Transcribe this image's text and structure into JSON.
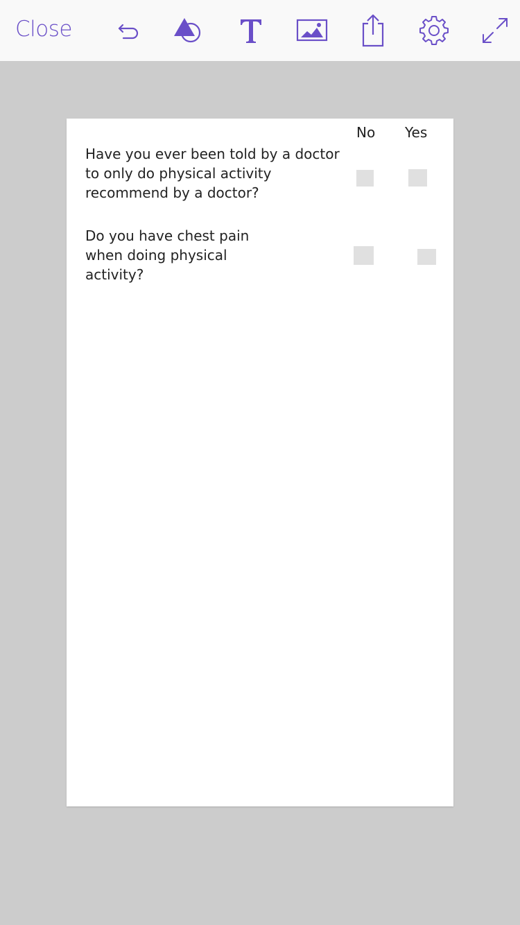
{
  "toolbar": {
    "close_label": "Close",
    "tools": [
      {
        "name": "undo-icon"
      },
      {
        "name": "shapes-icon"
      },
      {
        "name": "text-tool-icon"
      },
      {
        "name": "image-icon"
      },
      {
        "name": "share-icon"
      },
      {
        "name": "settings-gear-icon"
      },
      {
        "name": "fullscreen-expand-icon"
      }
    ],
    "accent_color": "#6a4fc8"
  },
  "form": {
    "col_no": "No",
    "col_yes": "Yes",
    "questions": [
      {
        "lines": [
          "Have you ever been told by a doctor",
          "to only do physical activity",
          "recommend by a doctor?"
        ]
      },
      {
        "lines": [
          "Do you have chest pain",
          "when doing physical",
          "activity?"
        ]
      }
    ]
  },
  "colors": {
    "background": "#cccccc",
    "toolbar_bg": "#f9f9f9",
    "page_bg": "#ffffff",
    "checkbox_fill": "#e0e0e0"
  }
}
